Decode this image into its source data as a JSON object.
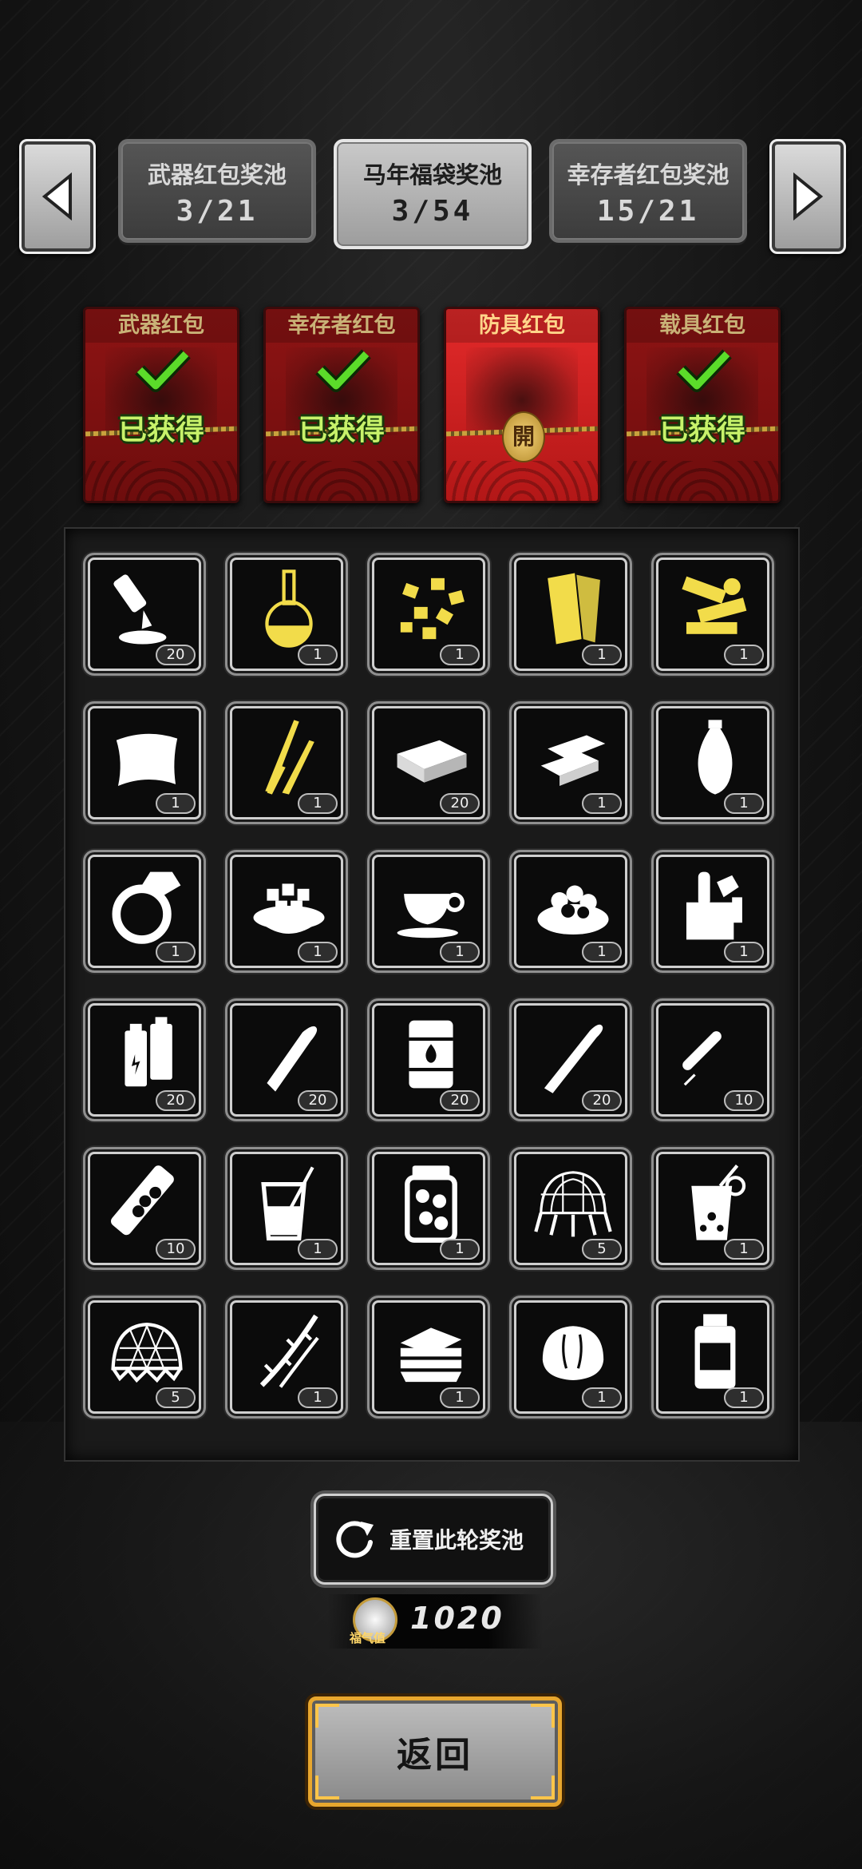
{
  "pools": [
    {
      "name": "武器红包奖池",
      "count": "3/21",
      "active": false
    },
    {
      "name": "马年福袋奖池",
      "count": "3/54",
      "active": true
    },
    {
      "name": "幸存者红包奖池",
      "count": "15/21",
      "active": false
    }
  ],
  "envelopes": [
    {
      "title": "武器红包",
      "obtained": true,
      "obtained_label": "已获得"
    },
    {
      "title": "幸存者红包",
      "obtained": true,
      "obtained_label": "已获得"
    },
    {
      "title": "防具红包",
      "obtained": false,
      "open_label": "開"
    },
    {
      "title": "载具红包",
      "obtained": true,
      "obtained_label": "已获得"
    }
  ],
  "items": [
    {
      "icon": "glue-tube-icon",
      "qty": "20",
      "color": "#ffffff"
    },
    {
      "icon": "chemical-flask-icon",
      "qty": "1",
      "color": "#f2dc4a"
    },
    {
      "icon": "gold-nuggets-icon",
      "qty": "1",
      "color": "#f2dc4a"
    },
    {
      "icon": "gold-bars-stack-icon",
      "qty": "1",
      "color": "#f2dc4a"
    },
    {
      "icon": "gold-scrap-parts-icon",
      "qty": "1",
      "color": "#f2dc4a"
    },
    {
      "icon": "pillow-icon",
      "qty": "1",
      "color": "#ffffff"
    },
    {
      "icon": "golden-sticks-icon",
      "qty": "1",
      "color": "#f2dc4a"
    },
    {
      "icon": "cash-bundle-icon",
      "qty": "20",
      "color": "#ffffff"
    },
    {
      "icon": "silver-ingot-icon",
      "qty": "1",
      "color": "#ffffff"
    },
    {
      "icon": "porcelain-vase-icon",
      "qty": "1",
      "color": "#ffffff"
    },
    {
      "icon": "diamond-ring-icon",
      "qty": "1",
      "color": "#ffffff"
    },
    {
      "icon": "food-bowl-icon",
      "qty": "1",
      "color": "#ffffff"
    },
    {
      "icon": "coffee-cup-icon",
      "qty": "1",
      "color": "#ffffff"
    },
    {
      "icon": "dumpling-plate-icon",
      "qty": "1",
      "color": "#ffffff"
    },
    {
      "icon": "toolbox-icon",
      "qty": "1",
      "color": "#ffffff"
    },
    {
      "icon": "batteries-icon",
      "qty": "20",
      "color": "#ffffff"
    },
    {
      "icon": "bullet-icon",
      "qty": "20",
      "color": "#ffffff"
    },
    {
      "icon": "fuel-barrel-icon",
      "qty": "20",
      "color": "#ffffff"
    },
    {
      "icon": "rifle-cartridge-icon",
      "qty": "20",
      "color": "#ffffff"
    },
    {
      "icon": "syringe-pen-icon",
      "qty": "10",
      "color": "#ffffff"
    },
    {
      "icon": "pill-tube-icon",
      "qty": "10",
      "color": "#ffffff"
    },
    {
      "icon": "drink-glass-icon",
      "qty": "1",
      "color": "#ffffff"
    },
    {
      "icon": "pickle-jar-icon",
      "qty": "1",
      "color": "#ffffff"
    },
    {
      "icon": "net-trap-icon",
      "qty": "5",
      "color": "#ffffff"
    },
    {
      "icon": "lemonade-icon",
      "qty": "1",
      "color": "#ffffff"
    },
    {
      "icon": "wire-mesh-icon",
      "qty": "5",
      "color": "#ffffff"
    },
    {
      "icon": "thorn-branch-icon",
      "qty": "1",
      "color": "#ffffff"
    },
    {
      "icon": "sandwich-icon",
      "qty": "1",
      "color": "#ffffff"
    },
    {
      "icon": "bread-icon",
      "qty": "1",
      "color": "#ffffff"
    },
    {
      "icon": "medicine-bottle-icon",
      "qty": "1",
      "color": "#ffffff"
    }
  ],
  "reset_button": {
    "label": "重置此轮奖池",
    "icon": "refresh-icon"
  },
  "fortune": {
    "caption": "福气值",
    "value": "1020",
    "icon": "fortune-medal-icon"
  },
  "back_button": {
    "label": "返回"
  }
}
